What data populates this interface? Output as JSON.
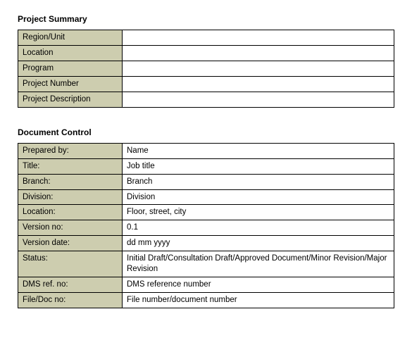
{
  "project_summary": {
    "title": "Project Summary",
    "rows": [
      {
        "label": "Region/Unit",
        "value": ""
      },
      {
        "label": "Location",
        "value": ""
      },
      {
        "label": "Program",
        "value": ""
      },
      {
        "label": "Project Number",
        "value": ""
      },
      {
        "label": "Project Description",
        "value": ""
      }
    ]
  },
  "document_control": {
    "title": "Document Control",
    "rows": [
      {
        "label": "Prepared by:",
        "value": "Name"
      },
      {
        "label": "Title:",
        "value": "Job title"
      },
      {
        "label": "Branch:",
        "value": "Branch"
      },
      {
        "label": "Division:",
        "value": "Division"
      },
      {
        "label": "Location:",
        "value": "Floor, street, city"
      },
      {
        "label": "Version no:",
        "value": "0.1"
      },
      {
        "label": "Version date:",
        "value": "dd mm yyyy"
      },
      {
        "label": "Status:",
        "value": "Initial Draft/Consultation Draft/Approved Document/Minor Revision/Major Revision"
      },
      {
        "label": "DMS ref. no:",
        "value": "DMS reference number"
      },
      {
        "label": "File/Doc no:",
        "value": "File number/document number"
      }
    ]
  }
}
